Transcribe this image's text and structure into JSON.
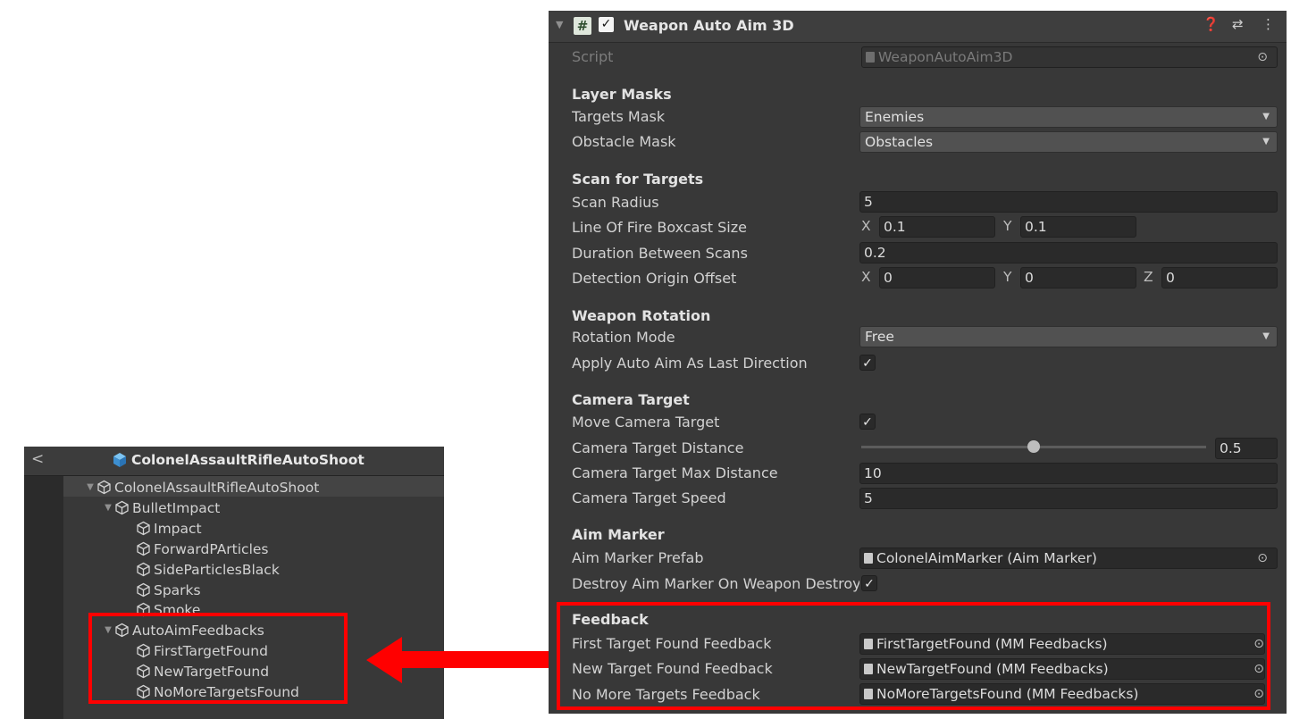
{
  "hierarchy": {
    "back_icon": "<",
    "prefab_title": "ColonelAssaultRifleAutoShoot",
    "items": [
      {
        "label": "ColonelAssaultRifleAutoShoot"
      },
      {
        "label": "BulletImpact"
      },
      {
        "label": "Impact"
      },
      {
        "label": "ForwardPArticles"
      },
      {
        "label": "SideParticlesBlack"
      },
      {
        "label": "Sparks"
      },
      {
        "label": "Smoke"
      },
      {
        "label": "AutoAimFeedbacks"
      },
      {
        "label": "FirstTargetFound"
      },
      {
        "label": "NewTargetFound"
      },
      {
        "label": "NoMoreTargetsFound"
      }
    ]
  },
  "inspector": {
    "component_title": "Weapon Auto Aim 3D",
    "hash_icon": "#",
    "enabled_check": "✓",
    "script": {
      "label": "Script",
      "value": "WeaponAutoAim3D"
    },
    "sections": {
      "layer_masks": "Layer Masks",
      "scan_for_targets": "Scan for Targets",
      "weapon_rotation": "Weapon Rotation",
      "camera_target": "Camera Target",
      "aim_marker": "Aim Marker",
      "feedback": "Feedback"
    },
    "targets_mask": {
      "label": "Targets Mask",
      "value": "Enemies"
    },
    "obstacle_mask": {
      "label": "Obstacle Mask",
      "value": "Obstacles"
    },
    "scan_radius": {
      "label": "Scan Radius",
      "value": "5"
    },
    "boxcast_size": {
      "label": "Line Of Fire Boxcast Size",
      "x_label": "X",
      "x": "0.1",
      "y_label": "Y",
      "y": "0.1"
    },
    "duration_between_scans": {
      "label": "Duration Between Scans",
      "value": "0.2"
    },
    "detection_origin_offset": {
      "label": "Detection Origin Offset",
      "x_label": "X",
      "x": "0",
      "y_label": "Y",
      "y": "0",
      "z_label": "Z",
      "z": "0"
    },
    "rotation_mode": {
      "label": "Rotation Mode",
      "value": "Free"
    },
    "apply_auto_aim_last_direction": {
      "label": "Apply Auto Aim As Last Direction",
      "checked": "✓"
    },
    "move_camera_target": {
      "label": "Move Camera Target",
      "checked": "✓"
    },
    "camera_target_distance": {
      "label": "Camera Target Distance",
      "value": "0.5",
      "level": 0.5
    },
    "camera_target_max_distance": {
      "label": "Camera Target Max Distance",
      "value": "10"
    },
    "camera_target_speed": {
      "label": "Camera Target Speed",
      "value": "5"
    },
    "aim_marker_prefab": {
      "label": "Aim Marker Prefab",
      "value": "ColonelAimMarker (Aim Marker)"
    },
    "destroy_aim_marker": {
      "label": "Destroy Aim Marker On Weapon Destroy",
      "checked": "✓"
    },
    "first_target_found_feedback": {
      "label": "First Target Found Feedback",
      "value": "FirstTargetFound (MM Feedbacks)"
    },
    "new_target_found_feedback": {
      "label": "New Target Found Feedback",
      "value": "NewTargetFound (MM Feedbacks)"
    },
    "no_more_targets_feedback": {
      "label": "No More Targets Feedback",
      "value": "NoMoreTargetsFound (MM Feedbacks)"
    }
  },
  "colors": {
    "highlight": "#ff0000",
    "panel_bg": "#383838",
    "prefab_blue": "#4fa3e0"
  }
}
